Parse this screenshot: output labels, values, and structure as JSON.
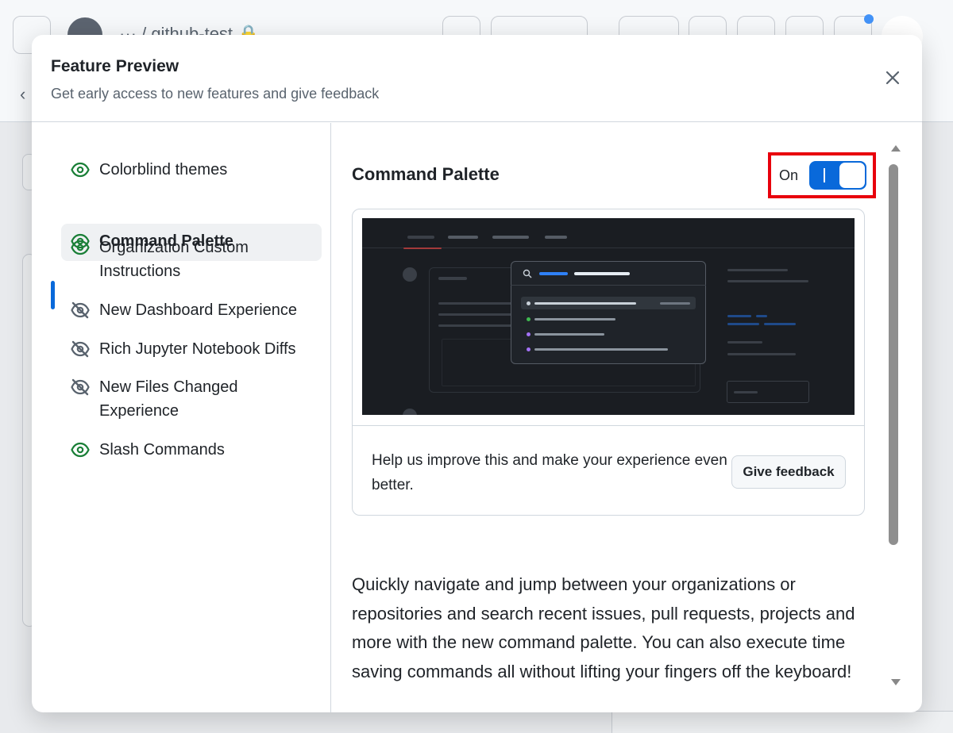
{
  "background": {
    "repo_path": "··· /  github-test 🔒"
  },
  "dialog": {
    "title": "Feature Preview",
    "subtitle": "Get early access to new features and give feedback",
    "close_icon": "close-icon"
  },
  "sidebar": {
    "items": [
      {
        "label": "Colorblind themes",
        "icon": "eye-icon",
        "enabled": true
      },
      {
        "label": "Command Palette",
        "icon": "eye-icon",
        "enabled": true,
        "selected": true
      },
      {
        "label": "Organization Custom Instructions",
        "icon": "eye-icon",
        "enabled": true
      },
      {
        "label": "New Dashboard Experience",
        "icon": "eye-closed-icon",
        "enabled": false
      },
      {
        "label": "Rich Jupyter Notebook Diffs",
        "icon": "eye-closed-icon",
        "enabled": false
      },
      {
        "label": "New Files Changed Experience",
        "icon": "eye-closed-icon",
        "enabled": false
      },
      {
        "label": "Slash Commands",
        "icon": "eye-icon",
        "enabled": true
      }
    ]
  },
  "main": {
    "feature_title": "Command Palette",
    "toggle": {
      "label": "On",
      "state": true,
      "mark": "I"
    },
    "feedback_text": "Help us improve this and make your experience even better.",
    "feedback_button": "Give feedback",
    "description": "Quickly navigate and jump between your organizations or repositories and search recent issues, pull requests, projects and more with the new command palette. You can also execute time saving commands all without lifting your fingers off the keyboard!"
  },
  "colors": {
    "accent": "#0969da",
    "enabled_icon": "#1a7f37",
    "disabled_icon": "#59636e",
    "highlight_box": "#e8000c"
  }
}
